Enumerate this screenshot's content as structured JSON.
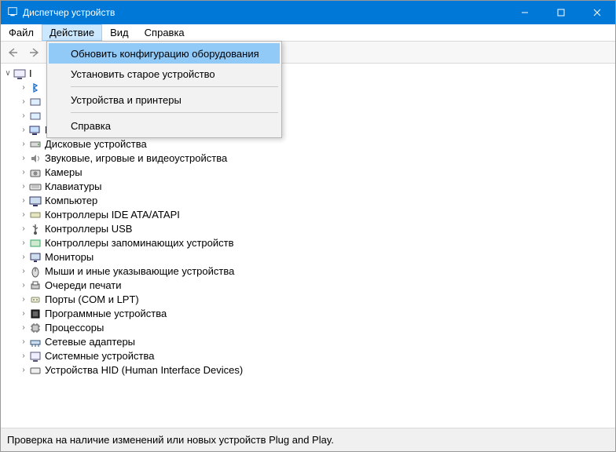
{
  "window": {
    "title": "Диспетчер устройств"
  },
  "menubar": {
    "file": "Файл",
    "action": "Действие",
    "view": "Вид",
    "help": "Справка"
  },
  "dropdown": {
    "refresh": "Обновить конфигурацию оборудования",
    "install_legacy": "Установить старое устройство",
    "devices_printers": "Устройства и принтеры",
    "help": "Справка"
  },
  "tree": {
    "bluetooth_cut": "I",
    "video": "Видеоадаптеры",
    "disk": "Дисковые устройства",
    "audio": "Звуковые, игровые и видеоустройства",
    "cameras": "Камеры",
    "keyboards": "Клавиатуры",
    "computer": "Компьютер",
    "ide": "Контроллеры IDE ATA/ATAPI",
    "usb": "Контроллеры USB",
    "storage": "Контроллеры запоминающих устройств",
    "monitors": "Мониторы",
    "mice": "Мыши и иные указывающие устройства",
    "printq": "Очереди печати",
    "ports": "Порты (COM и LPT)",
    "software": "Программные устройства",
    "cpu": "Процессоры",
    "net": "Сетевые адаптеры",
    "system": "Системные устройства",
    "hid": "Устройства HID (Human Interface Devices)"
  },
  "status": "Проверка на наличие изменений или новых устройств Plug and Play."
}
